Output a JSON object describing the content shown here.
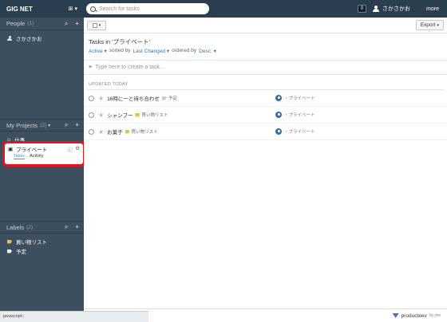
{
  "topbar": {
    "org_name": "GIG NET",
    "search_placeholder": "Search for tasks",
    "notification_count": "0",
    "user_name": "さかさかお",
    "more_label": "more"
  },
  "sidebar": {
    "people": {
      "title": "People",
      "count": "(1)",
      "items": [
        {
          "name": "さかさかお"
        }
      ]
    },
    "projects": {
      "title": "My Projects",
      "count": "(2)",
      "items": [
        {
          "name": "仕事"
        },
        {
          "name": "プライベート"
        }
      ],
      "selected_tabs": {
        "tasks": "Tasks",
        "activity": "Activity"
      }
    },
    "labels": {
      "title": "Labels",
      "count": "(2)",
      "items": [
        {
          "name": "買い物リスト"
        },
        {
          "name": "予定"
        }
      ]
    }
  },
  "toolbar": {
    "export_label": "Export"
  },
  "heading": {
    "title": "Tasks in 'プライベート'",
    "filter_active": "Active",
    "sorted_by_text": "sorted by",
    "sort_field": "Last Changed",
    "ordered_by_text": "ordered by",
    "order": "Desc."
  },
  "create_placeholder": "Type here to create a task...",
  "group_label": "UPDATED TODAY",
  "tasks": [
    {
      "title": "16時に一と待ち合わせ",
      "label": "予定",
      "assignee": "・プライベート"
    },
    {
      "title": "シャンプー",
      "label": "買い物リスト",
      "assignee": "・プライベート"
    },
    {
      "title": "お菓子",
      "label": "買い物リスト",
      "assignee": "・プライベート"
    }
  ],
  "footer": {
    "brand": "producteev",
    "by": "by jive"
  },
  "statusbar_text": "javascript:;"
}
